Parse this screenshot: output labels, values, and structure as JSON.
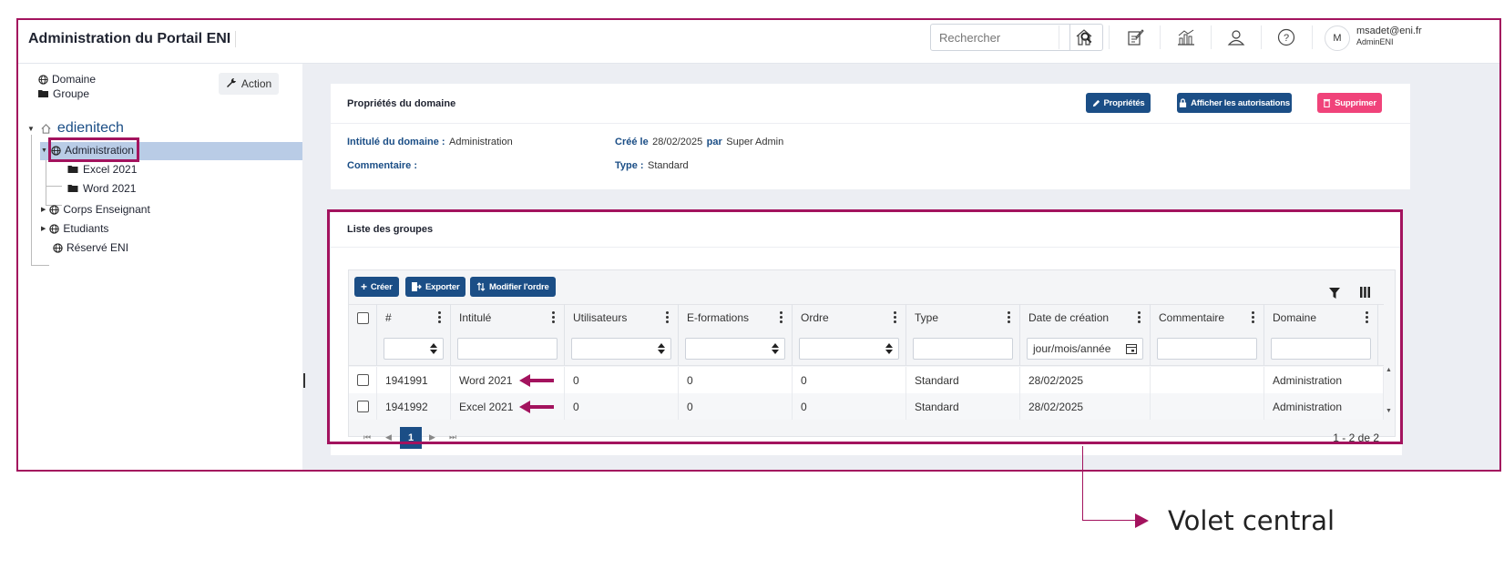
{
  "header": {
    "title": "Administration du Portail ENI",
    "search_placeholder": "Rechercher",
    "avatar_initial": "M",
    "user_email": "msadet@eni.fr",
    "user_role": "AdminENI"
  },
  "sidebar": {
    "links": [
      "Domaine",
      "Groupe"
    ],
    "action_label": "Action",
    "tree_root": "edienitech",
    "tree": [
      {
        "label": "Administration",
        "type": "domain",
        "level": 1,
        "expanded": true,
        "selected": true
      },
      {
        "label": "Excel 2021",
        "type": "group",
        "level": 2
      },
      {
        "label": "Word 2021",
        "type": "group",
        "level": 2
      },
      {
        "label": "Corps Enseignant",
        "type": "domain",
        "level": 1,
        "expanded": false
      },
      {
        "label": "Etudiants",
        "type": "domain",
        "level": 1,
        "expanded": false
      },
      {
        "label": "Réservé ENI",
        "type": "domain",
        "level": 1
      }
    ]
  },
  "properties": {
    "title": "Propriétés du domaine",
    "btn_props": "Propriétés",
    "btn_auth": "Afficher les autorisations",
    "btn_delete": "Supprimer",
    "domain_label": "Intitulé du domaine :",
    "domain_value": "Administration",
    "created_label": "Créé le",
    "created_date": "28/02/2025",
    "created_by_label": "par",
    "created_by": "Super Admin",
    "comment_label": "Commentaire :",
    "type_label": "Type :",
    "type_value": "Standard"
  },
  "groups": {
    "title": "Liste des groupes",
    "toolbar": {
      "create": "Créer",
      "export": "Exporter",
      "reorder": "Modifier l'ordre"
    },
    "columns": [
      "#",
      "Intitulé",
      "Utilisateurs",
      "E-formations",
      "Ordre",
      "Type",
      "Date de création",
      "Commentaire",
      "Domaine"
    ],
    "date_placeholder": "jour/mois/année",
    "rows": [
      {
        "id": "1941991",
        "name": "Word 2021",
        "users": "0",
        "eformations": "0",
        "order": "0",
        "type": "Standard",
        "created": "28/02/2025",
        "comment": "",
        "domain": "Administration"
      },
      {
        "id": "1941992",
        "name": "Excel 2021",
        "users": "0",
        "eformations": "0",
        "order": "0",
        "type": "Standard",
        "created": "28/02/2025",
        "comment": "",
        "domain": "Administration"
      }
    ],
    "pager": {
      "current": "1",
      "info": "1 - 2 de 2"
    }
  },
  "callout": {
    "label": "Volet central"
  },
  "colors": {
    "brand": "#1b4e86",
    "highlight": "#a3135e",
    "danger": "#f0437a",
    "selected_row": "#b9cce6"
  }
}
